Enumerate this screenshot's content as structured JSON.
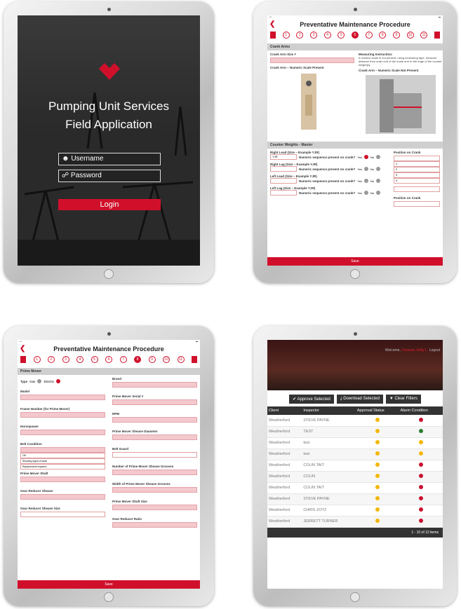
{
  "login": {
    "title_line1": "Pumping Unit Services",
    "title_line2": "Field Application",
    "username_placeholder": "Username",
    "password_placeholder": "Password",
    "login_label": "Login"
  },
  "pm": {
    "header": "Preventative Maintenance Procedure",
    "steps": [
      "1",
      "2",
      "3",
      "4",
      "5",
      "6",
      "7",
      "8",
      "9",
      "10",
      "11"
    ],
    "save_label": "Save"
  },
  "crank": {
    "section": "Crank Arms",
    "size_label": "Crank Arm Size #",
    "instruction_title": "Measuring Instruction:",
    "instruction_text": "If numeric scale is not present, using measuring tape, measure distance from outer end of the crank arm to the edge of the counter weight(s).",
    "img1_caption": "Crank Arm – Numeric Scale Present",
    "img2_caption": "Crank Arm – Numeric Scale Not Present",
    "cw_section": "Counter Weights - Master",
    "rows": [
      {
        "label": "Right Lead (Size – Example YJR)",
        "value": "YJR",
        "question": "Numeric sequence present on crank?"
      },
      {
        "label": "Right Lag (Size – Example YJR)",
        "value": "",
        "question": "Numeric sequence present on crank?"
      },
      {
        "label": "Left Lead (Size – Example YJR)",
        "value": "",
        "question": "Numeric sequence present on crank?"
      },
      {
        "label": "Left Lag (Size – Example YJR)",
        "value": "",
        "question": "Numeric sequence present on crank?"
      }
    ],
    "yes": "Yes",
    "no": "No",
    "position_label": "Position on Crank",
    "position_options": [
      "1",
      "2",
      "3",
      "4"
    ]
  },
  "prime": {
    "section": "Prime Mover",
    "type_label": "Type",
    "gas": "Gas",
    "electric": "Electric",
    "left": [
      "Model",
      "Frame Number (for Prime Mover)",
      "Horsepower",
      "Belt Condition",
      "Prime Mover Shaft",
      "Gear Reducer Sheave",
      "Gear Reducer Sheave Size"
    ],
    "right": [
      "Brand",
      "Prime Mover Serial #",
      "RPM",
      "Prime Mover Sheave Diameter",
      "Belt Guard",
      "Number of Prime Mover Sheave Grooves",
      "Width of Prime Mover Sheave Grooves",
      "Prime Mover Shaft Size",
      "Gear Reducer Ratio"
    ],
    "belt_options": [
      "OK",
      "Showing signs of wear",
      "Replacement required"
    ]
  },
  "approvals": {
    "welcome": "Welcome,",
    "user": "Creason, Kelly L.",
    "logout": "Logout",
    "approve_label": "Approve Selected",
    "download_label": "Download Selected",
    "clear_label": "Clear Filters",
    "columns": [
      "Client",
      "Inspector",
      "Approval Status",
      "Alarm Condition"
    ],
    "rows": [
      {
        "client": "Weatherford",
        "inspector": "STEVE PAYNE",
        "approval": "#f2b705",
        "alarm": "#c8102e"
      },
      {
        "client": "Weatherford",
        "inspector": "TEST",
        "approval": "#f2b705",
        "alarm": "#2e7d32"
      },
      {
        "client": "Weatherford",
        "inspector": "test",
        "approval": "#f2b705",
        "alarm": "#f2b705"
      },
      {
        "client": "Weatherford",
        "inspector": "test",
        "approval": "#f2b705",
        "alarm": "#f2b705"
      },
      {
        "client": "Weatherford",
        "inspector": "COLIN TAIT",
        "approval": "#f2b705",
        "alarm": "#c8102e"
      },
      {
        "client": "Weatherford",
        "inspector": "COLIN",
        "approval": "#f2b705",
        "alarm": "#c8102e"
      },
      {
        "client": "Weatherford",
        "inspector": "COLIN TAIT",
        "approval": "#f2b705",
        "alarm": "#c8102e"
      },
      {
        "client": "Weatherford",
        "inspector": "STEVE PAYNE",
        "approval": "#f2b705",
        "alarm": "#c8102e"
      },
      {
        "client": "Weatherford",
        "inspector": "CHRIS ZOTZ",
        "approval": "#f2b705",
        "alarm": "#c8102e"
      },
      {
        "client": "Weatherford",
        "inspector": "JERRETT TURNER",
        "approval": "#f2b705",
        "alarm": "#c8102e"
      }
    ],
    "pager": "1 - 10 of 12 items"
  }
}
